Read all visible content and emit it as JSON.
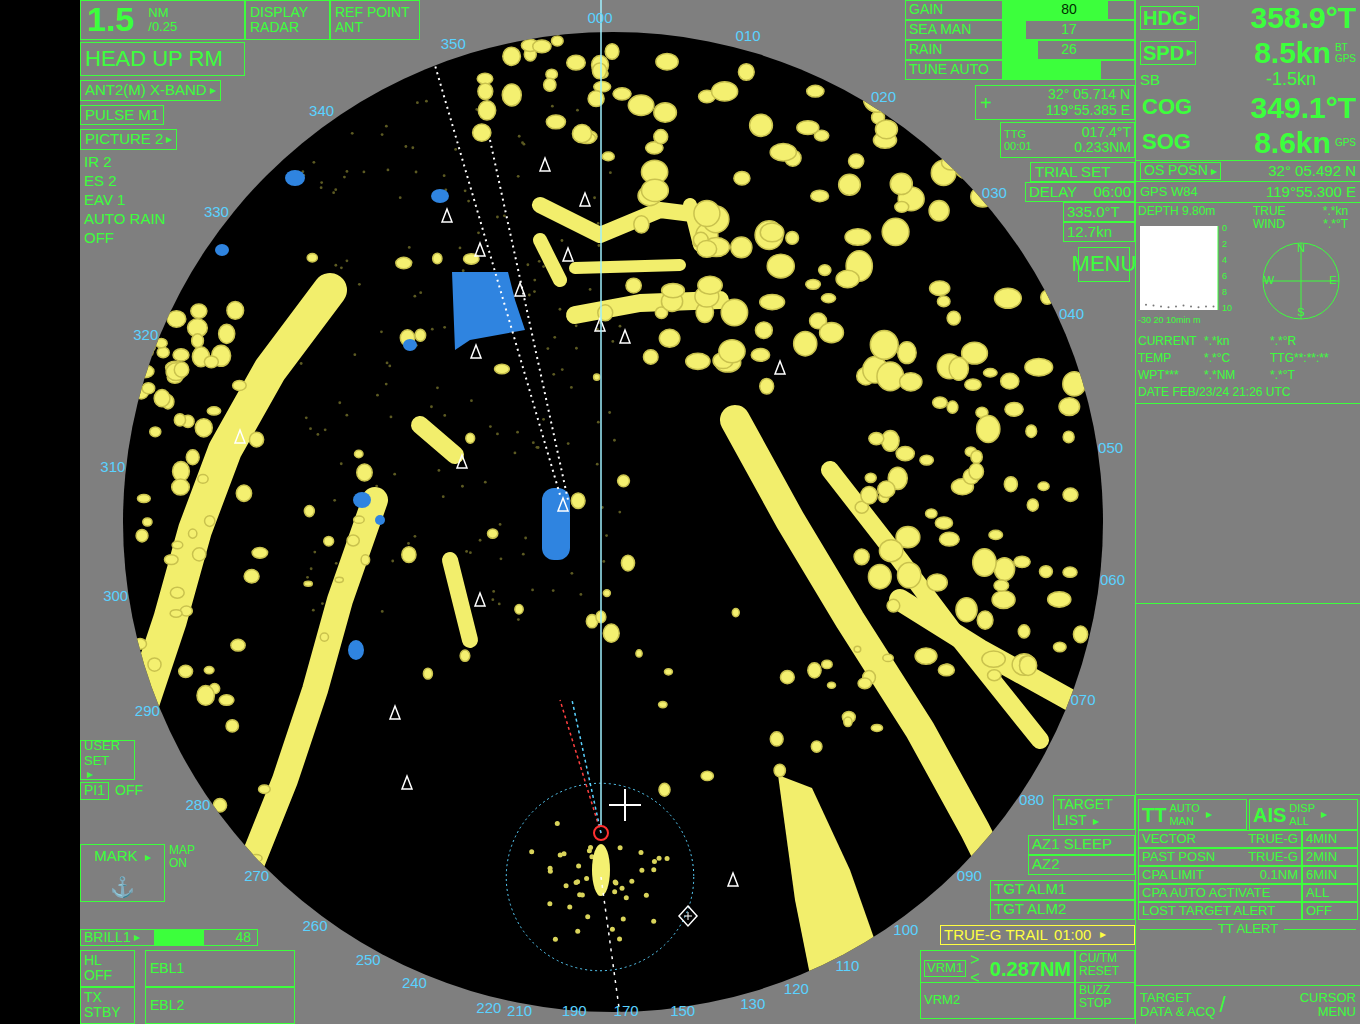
{
  "range": {
    "value": "1.5",
    "unit": "NM",
    "ring": "/0.25"
  },
  "display": {
    "label": "DISPLAY",
    "value": "RADAR"
  },
  "ref_point": {
    "label": "REF POINT",
    "value": "ANT"
  },
  "mode": "HEAD UP RM",
  "left_menu": [
    {
      "label": "ANT2(M) X-BAND",
      "arrow": "▸"
    },
    {
      "label": "PULSE M1",
      "arrow": ""
    },
    {
      "label": "PICTURE 2",
      "arrow": "▸"
    }
  ],
  "picture_settings": [
    "IR 2",
    "ES 2",
    "EAV 1",
    "AUTO RAIN",
    "OFF"
  ],
  "user_set": {
    "label": "USER SET",
    "arrow": "▸"
  },
  "pi": {
    "label": "PI1",
    "value": "OFF"
  },
  "mark": {
    "label": "MARK",
    "arrow": "▸",
    "map": "MAP ON",
    "icon": "⚓"
  },
  "brill": {
    "label": "BRILL1",
    "arrow": "▸",
    "value": "48",
    "level": 0.48
  },
  "bottom_left": [
    {
      "label": "HL OFF",
      "value": "EBL1"
    },
    {
      "label": "TX STBY",
      "value": "EBL2"
    }
  ],
  "adjust": [
    {
      "label": "GAIN",
      "value": "80",
      "level": 0.8
    },
    {
      "label": "SEA MAN",
      "value": "17",
      "level": 0.17
    },
    {
      "label": "RAIN",
      "value": "26",
      "level": 0.26
    },
    {
      "label": "TUNE AUTO",
      "value": "",
      "level": 0.75
    }
  ],
  "cursor": {
    "icon": "+",
    "lat": "32° 05.714 N",
    "lon": "119°55.385 E",
    "ttg_label": "TTG",
    "ttg_time": "00:01",
    "bearing": "017.4°T",
    "range": "0.233NM"
  },
  "trial": {
    "label": "TRIAL SET",
    "delay_label": "DELAY",
    "delay": "06:00",
    "course": "335.0°T",
    "speed": "12.7kn"
  },
  "menu": "MENU",
  "own_ship": {
    "hdg": {
      "label": "HDG",
      "arrow": "▸",
      "value": "358.9°T"
    },
    "spd": {
      "label": "SPD",
      "arrow": "▸",
      "value": "8.5kn",
      "sources": [
        "BT",
        "GPS"
      ]
    },
    "sb": {
      "label": "SB",
      "value": "-1.5kn"
    },
    "cog": {
      "label": "COG",
      "value": "349.1°T"
    },
    "sog": {
      "label": "SOG",
      "value": "8.6kn",
      "source": "GPS"
    }
  },
  "position": {
    "label": "OS POSN",
    "arrow": "▸",
    "lat": "32° 05.492 N",
    "datum": "GPS W84",
    "lon": "119°55.300 E"
  },
  "depth": {
    "label": "DEPTH 9.80m",
    "ticks": [
      "0",
      "2",
      "4",
      "6",
      "8",
      "10"
    ],
    "axis": "-30 20 10min m",
    "values": [
      9.6,
      9.7,
      9.8,
      9.9,
      9.8,
      9.7,
      9.8,
      9.9,
      9.8,
      9.8
    ]
  },
  "wind": {
    "label": "TRUE WIND",
    "speed": "*.*kn",
    "direction": "*.*°T",
    "compass": [
      "N",
      "E",
      "S",
      "W"
    ]
  },
  "info": [
    {
      "label": "CURRENT",
      "value": "*.*kn",
      "extra": "*.*°R"
    },
    {
      "label": "TEMP",
      "value": "*.*°C",
      "extra": "TTG**:**:**"
    },
    {
      "label": "WPT***",
      "value": "*.*NM",
      "extra": "*.*°T"
    }
  ],
  "date": "DATE FEB/23/24 21:26 UTC",
  "target_list": {
    "label": "TARGET LIST",
    "arrow": "▸"
  },
  "az": [
    "AZ1 SLEEP",
    "AZ2"
  ],
  "tgt_alm": [
    "TGT ALM1",
    "TGT ALM2"
  ],
  "trail": {
    "label": "TRUE-G TRAIL",
    "value": "01:00",
    "arrow": "▸"
  },
  "vrm": [
    {
      "label": "VRM1",
      "mark": "><",
      "value": "0.287NM",
      "active": true,
      "button": "CU/TM RESET"
    },
    {
      "label": "VRM2",
      "mark": "",
      "value": "",
      "active": false,
      "button": "BUZZ STOP"
    }
  ],
  "tt": {
    "label": "TT",
    "options": [
      "AUTO",
      "MAN"
    ],
    "arrow": "▸"
  },
  "ais": {
    "label": "AIS",
    "options": [
      "DISP",
      "ALL"
    ],
    "arrow": "▸"
  },
  "tt_settings": [
    {
      "label": "VECTOR",
      "value": "TRUE-G",
      "extra": "4MIN"
    },
    {
      "label": "PAST POSN",
      "value": "TRUE-G",
      "extra": "2MIN"
    },
    {
      "label": "CPA LIMIT",
      "value": "0.1NM",
      "extra": "6MIN"
    },
    {
      "label": "CPA AUTO ACTIVATE",
      "value": "",
      "extra": "ALL"
    },
    {
      "label": "LOST TARGET ALERT",
      "value": "",
      "extra": "OFF"
    }
  ],
  "tt_alert": "TT ALERT",
  "footer": {
    "left": [
      "TARGET",
      "DATA & ACQ"
    ],
    "separator": "/",
    "right": [
      "CURSOR",
      "MENU"
    ]
  },
  "bearings": [
    "000",
    "010",
    "020",
    "030",
    "040",
    "050",
    "060",
    "070",
    "080",
    "090",
    "100",
    "110",
    "120",
    "130",
    "150",
    "170",
    "190",
    "210",
    "220",
    "240",
    "250",
    "260",
    "270",
    "280",
    "290",
    "300",
    "310",
    "320",
    "330",
    "340",
    "350"
  ]
}
